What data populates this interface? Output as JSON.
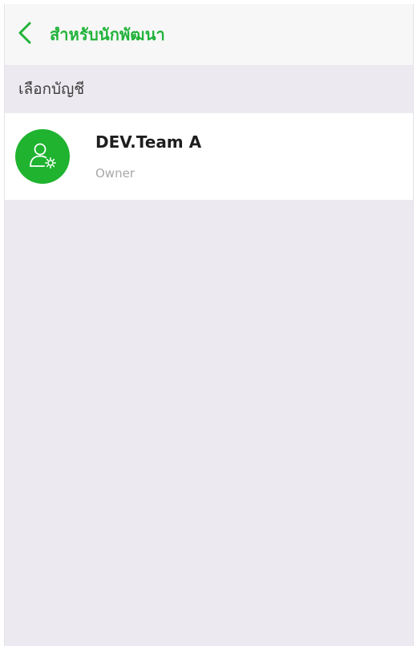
{
  "nav": {
    "back_icon": "chevron-left-icon",
    "title": "สำหรับนักพัฒนา",
    "accent_color": "#20b33a"
  },
  "section": {
    "header": "เลือกบัญชี"
  },
  "accounts": [
    {
      "name": "DEV.Team A",
      "role": "Owner",
      "avatar_icon": "user-gear-icon",
      "avatar_color": "#1fb32f"
    }
  ]
}
